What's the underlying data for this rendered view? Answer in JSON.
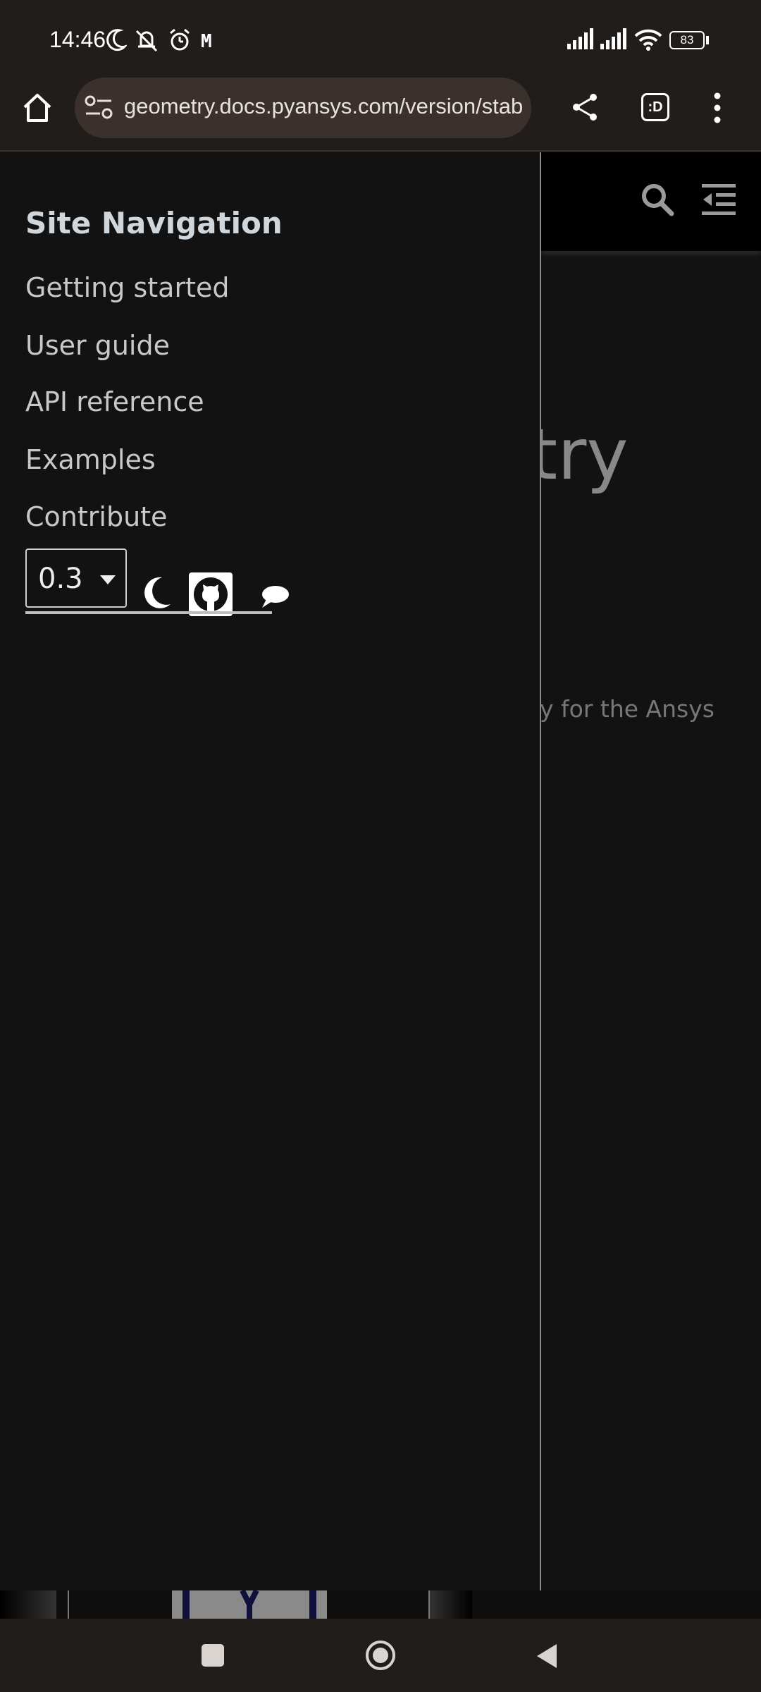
{
  "status_bar": {
    "time": "14:46",
    "indicator_letter": "M",
    "battery_level": "83"
  },
  "browser": {
    "url": "geometry.docs.pyansys.com/version/stable",
    "tab_switcher_label": ":D"
  },
  "page": {
    "title_fragment": "try",
    "subtitle_fragment": "y for the Ansys"
  },
  "sidebar": {
    "title": "Site Navigation",
    "items": [
      {
        "label": "Getting started"
      },
      {
        "label": "User guide"
      },
      {
        "label": "API reference"
      },
      {
        "label": "Examples"
      },
      {
        "label": "Contribute"
      }
    ],
    "version": "0.3"
  },
  "colors": {
    "drawer_bg": "#121212",
    "chrome_bg": "#211d1b",
    "url_pill_bg": "#3a302c",
    "nav_text": "#c8c8c8"
  },
  "icons": {
    "status": [
      "moon-icon",
      "muted-bell-icon",
      "alarm-icon",
      "signal-icon",
      "wifi-icon",
      "battery-icon"
    ],
    "toolbar": [
      "home-icon",
      "site-settings-icon",
      "share-icon",
      "tab-switcher-icon",
      "more-menu-icon"
    ],
    "page": [
      "search-icon",
      "toc-toggle-icon"
    ],
    "drawer": [
      "dark-mode-icon",
      "github-icon",
      "discussions-icon"
    ],
    "system_nav": [
      "recents-icon",
      "home-circle-icon",
      "back-icon"
    ]
  }
}
